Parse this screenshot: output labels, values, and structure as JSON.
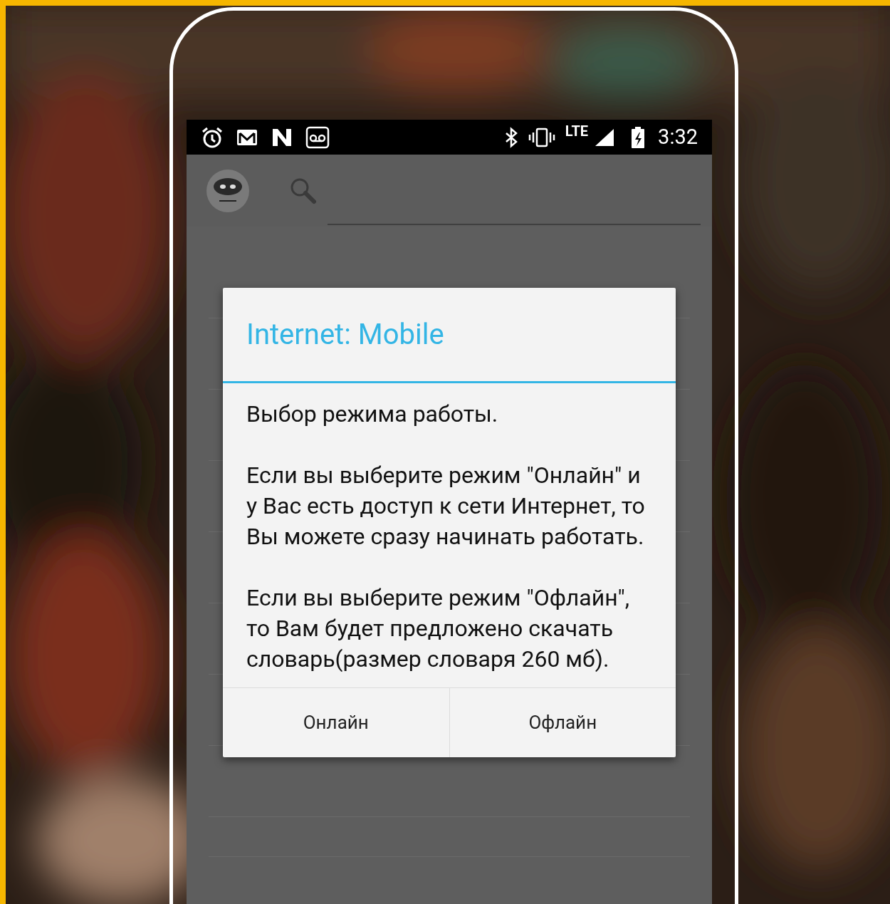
{
  "status_bar": {
    "network": "LTE",
    "time": "3:32"
  },
  "dialog": {
    "title": "Internet: Mobile",
    "paragraphs": [
      "Выбор режима работы.",
      "Если вы выберите режим \"Онлайн\" и у Вас есть доступ к сети Интернет, то Вы можете сразу начинать работать.",
      "Если вы выберите режим \"Офлайн\", то Вам будет предложено скачать словарь(размер словаря 260 мб)."
    ],
    "buttons": [
      "Онлайн",
      "Офлайн"
    ]
  }
}
